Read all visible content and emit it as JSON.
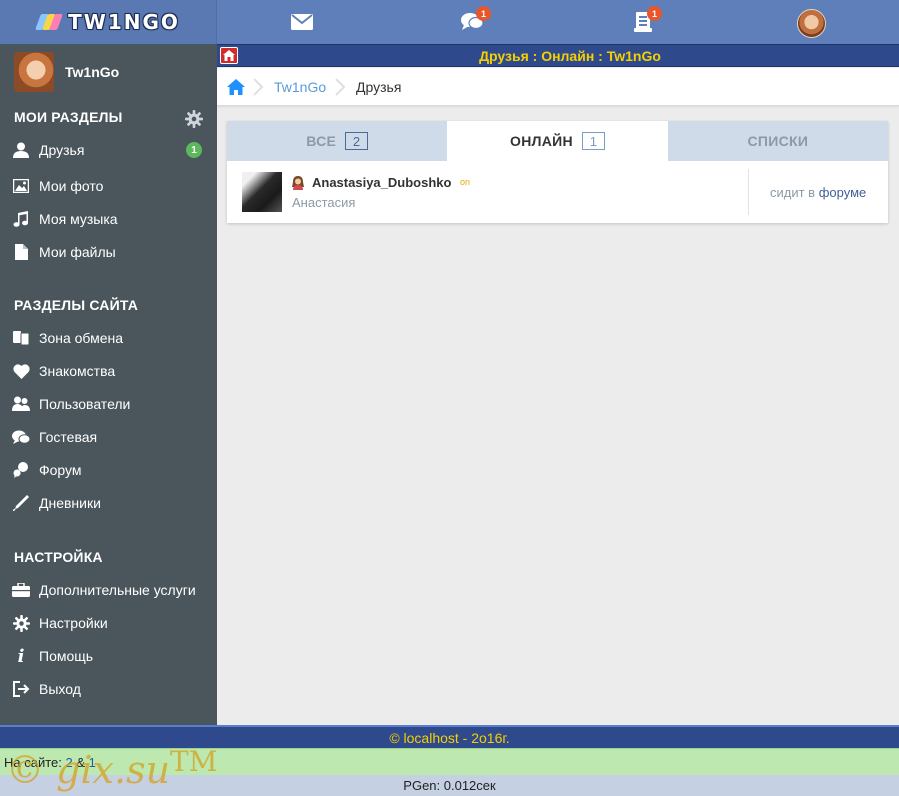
{
  "app": {
    "logo_text": "TW1NGO",
    "logo_colors": [
      "#8bc6ff",
      "#f7d64a",
      "#ff7fb0"
    ]
  },
  "topbar": {
    "icons": [
      {
        "name": "mail-icon",
        "badge": ""
      },
      {
        "name": "chat-icon",
        "badge": "1"
      },
      {
        "name": "notifications-icon",
        "badge": "1"
      }
    ]
  },
  "sidebar": {
    "user": {
      "name": "Tw1nGo"
    },
    "sections": {
      "my": "МОИ РАЗДЕЛЫ",
      "site": "РАЗДЕЛЫ САЙТА",
      "settings": "НАСТРОЙКА"
    },
    "my_items": [
      {
        "label": "Друзья",
        "icon": "user-icon",
        "count": "1"
      },
      {
        "label": "Мои фото",
        "icon": "photo-icon"
      },
      {
        "label": "Моя музыка",
        "icon": "music-icon"
      },
      {
        "label": "Мои файлы",
        "icon": "file-icon"
      }
    ],
    "site_items": [
      {
        "label": "Зона обмена",
        "icon": "exchange-icon"
      },
      {
        "label": "Знакомства",
        "icon": "heart-icon"
      },
      {
        "label": "Пользователи",
        "icon": "users-icon"
      },
      {
        "label": "Гостевая",
        "icon": "chat-icon"
      },
      {
        "label": "Форум",
        "icon": "forum-icon"
      },
      {
        "label": "Дневники",
        "icon": "pen-icon"
      }
    ],
    "settings_items": [
      {
        "label": "Дополнительные услуги",
        "icon": "briefcase-icon"
      },
      {
        "label": "Настройки",
        "icon": "gear-icon"
      },
      {
        "label": "Помощь",
        "icon": "info-icon"
      },
      {
        "label": "Выход",
        "icon": "logout-icon"
      }
    ]
  },
  "titlebar": {
    "text": "Друзья : Онлайн : Tw1nGo"
  },
  "breadcrumb": {
    "link": "Tw1nGo",
    "current": "Друзья"
  },
  "tabs": [
    {
      "label": "ВСЕ",
      "count": "2",
      "active": false
    },
    {
      "label": "ОНЛАЙН",
      "count": "1",
      "active": true
    },
    {
      "label": "СПИСКИ",
      "count": "",
      "active": false
    }
  ],
  "friends": [
    {
      "username": "Anastasiya_Duboshko",
      "online": "on",
      "real_name": "Анастасия",
      "status_prefix": "сидит в",
      "status_link": "форуме"
    }
  ],
  "footer": {
    "copyright": "© localhost - 2o16г.",
    "online_label": "На сайте:",
    "online_a": "2",
    "online_sep": "&",
    "online_b": "1",
    "pgen": "PGen: 0.012сек"
  },
  "watermark": {
    "text": "© gix.su",
    "tm": "TM"
  },
  "colors": {
    "header": "#5f7fba",
    "sidebar": "#4a565c",
    "titlebar": "#2e4a8d",
    "title_text": "#f5d000",
    "badge": "#e8562c",
    "count_badge": "#5cb85c",
    "online_bar": "#bde8b0"
  }
}
